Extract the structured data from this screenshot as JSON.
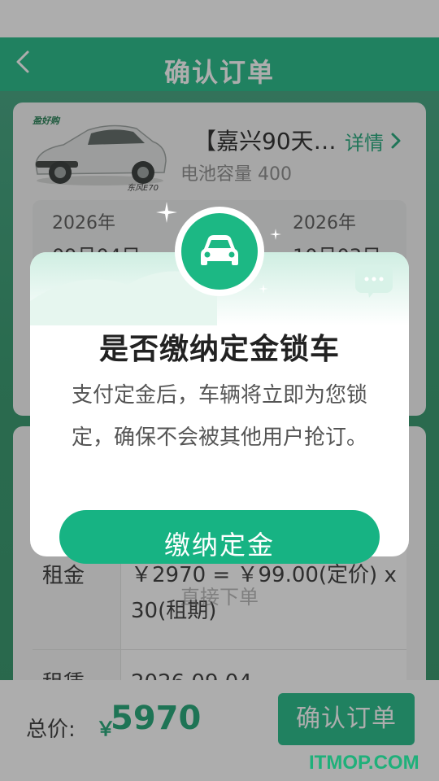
{
  "header": {
    "title": "确认订单"
  },
  "product": {
    "brand": "盈好购",
    "model": "东风E70",
    "name": "【嘉兴90天…",
    "detail_label": "详情",
    "battery": "电池容量 400"
  },
  "dates": {
    "start_year": "2026年",
    "start_md": "09月04日",
    "end_year": "2026年",
    "end_md": "10月03日"
  },
  "fees": {
    "rent_label": "租金",
    "rent_value": "￥2970 = ￥99.00(定价) x 30(租期)",
    "lease_label": "租赁",
    "lease_value": "2026.09.04"
  },
  "modal": {
    "title": "是否缴纳定金锁车",
    "message": "支付定金后，车辆将立即为您锁定，确保不会被其他用户抢订。",
    "pay_button": "缴纳定金",
    "skip_link": "直接下单"
  },
  "bottom": {
    "total_label": "总价:",
    "currency": "￥",
    "total_value": "5970",
    "confirm_button": "确认订单"
  },
  "watermark": "ITMOP.COM",
  "colors": {
    "accent": "#1cb884",
    "price": "#19a472"
  }
}
